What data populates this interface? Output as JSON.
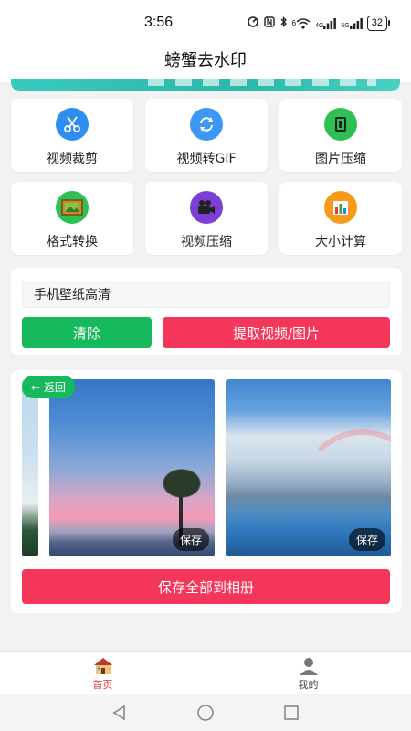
{
  "status_bar": {
    "time": "3:56",
    "icons": [
      "link-icon",
      "nfc-icon",
      "bluetooth-icon",
      "wifi-6-icon",
      "4g-signal-icon",
      "5g-signal-icon"
    ],
    "network_4g": "4G",
    "network_5g": "5G",
    "wifi_label": "6",
    "battery": "32"
  },
  "header": {
    "title": "螃蟹去水印"
  },
  "tools": [
    {
      "label": "视频裁剪",
      "icon": "scissors-icon",
      "color": "#2e8ef0"
    },
    {
      "label": "视频转GIF",
      "icon": "refresh-icon",
      "color": "#3d98f5"
    },
    {
      "label": "图片压缩",
      "icon": "compress-icon",
      "color": "#2ebf55"
    },
    {
      "label": "格式转换",
      "icon": "picture-frame-icon",
      "color": "#2ebf55"
    },
    {
      "label": "视频压缩",
      "icon": "camera-icon",
      "color": "#7b3fd6"
    },
    {
      "label": "大小计算",
      "icon": "bar-chart-icon",
      "color": "#f59a1b"
    }
  ],
  "input_panel": {
    "value": "手机壁纸高清",
    "clear_label": "清除",
    "extract_label": "提取视频/图片"
  },
  "results": {
    "back_label": "← 返回",
    "save_label": "保存",
    "save_all_label": "保存全部到相册"
  },
  "tabs": [
    {
      "label": "首页",
      "icon": "home-icon",
      "active": true
    },
    {
      "label": "我的",
      "icon": "user-icon",
      "active": false
    }
  ],
  "colors": {
    "green": "#17b95d",
    "red": "#f3365a",
    "active_tab": "#e2312b"
  }
}
